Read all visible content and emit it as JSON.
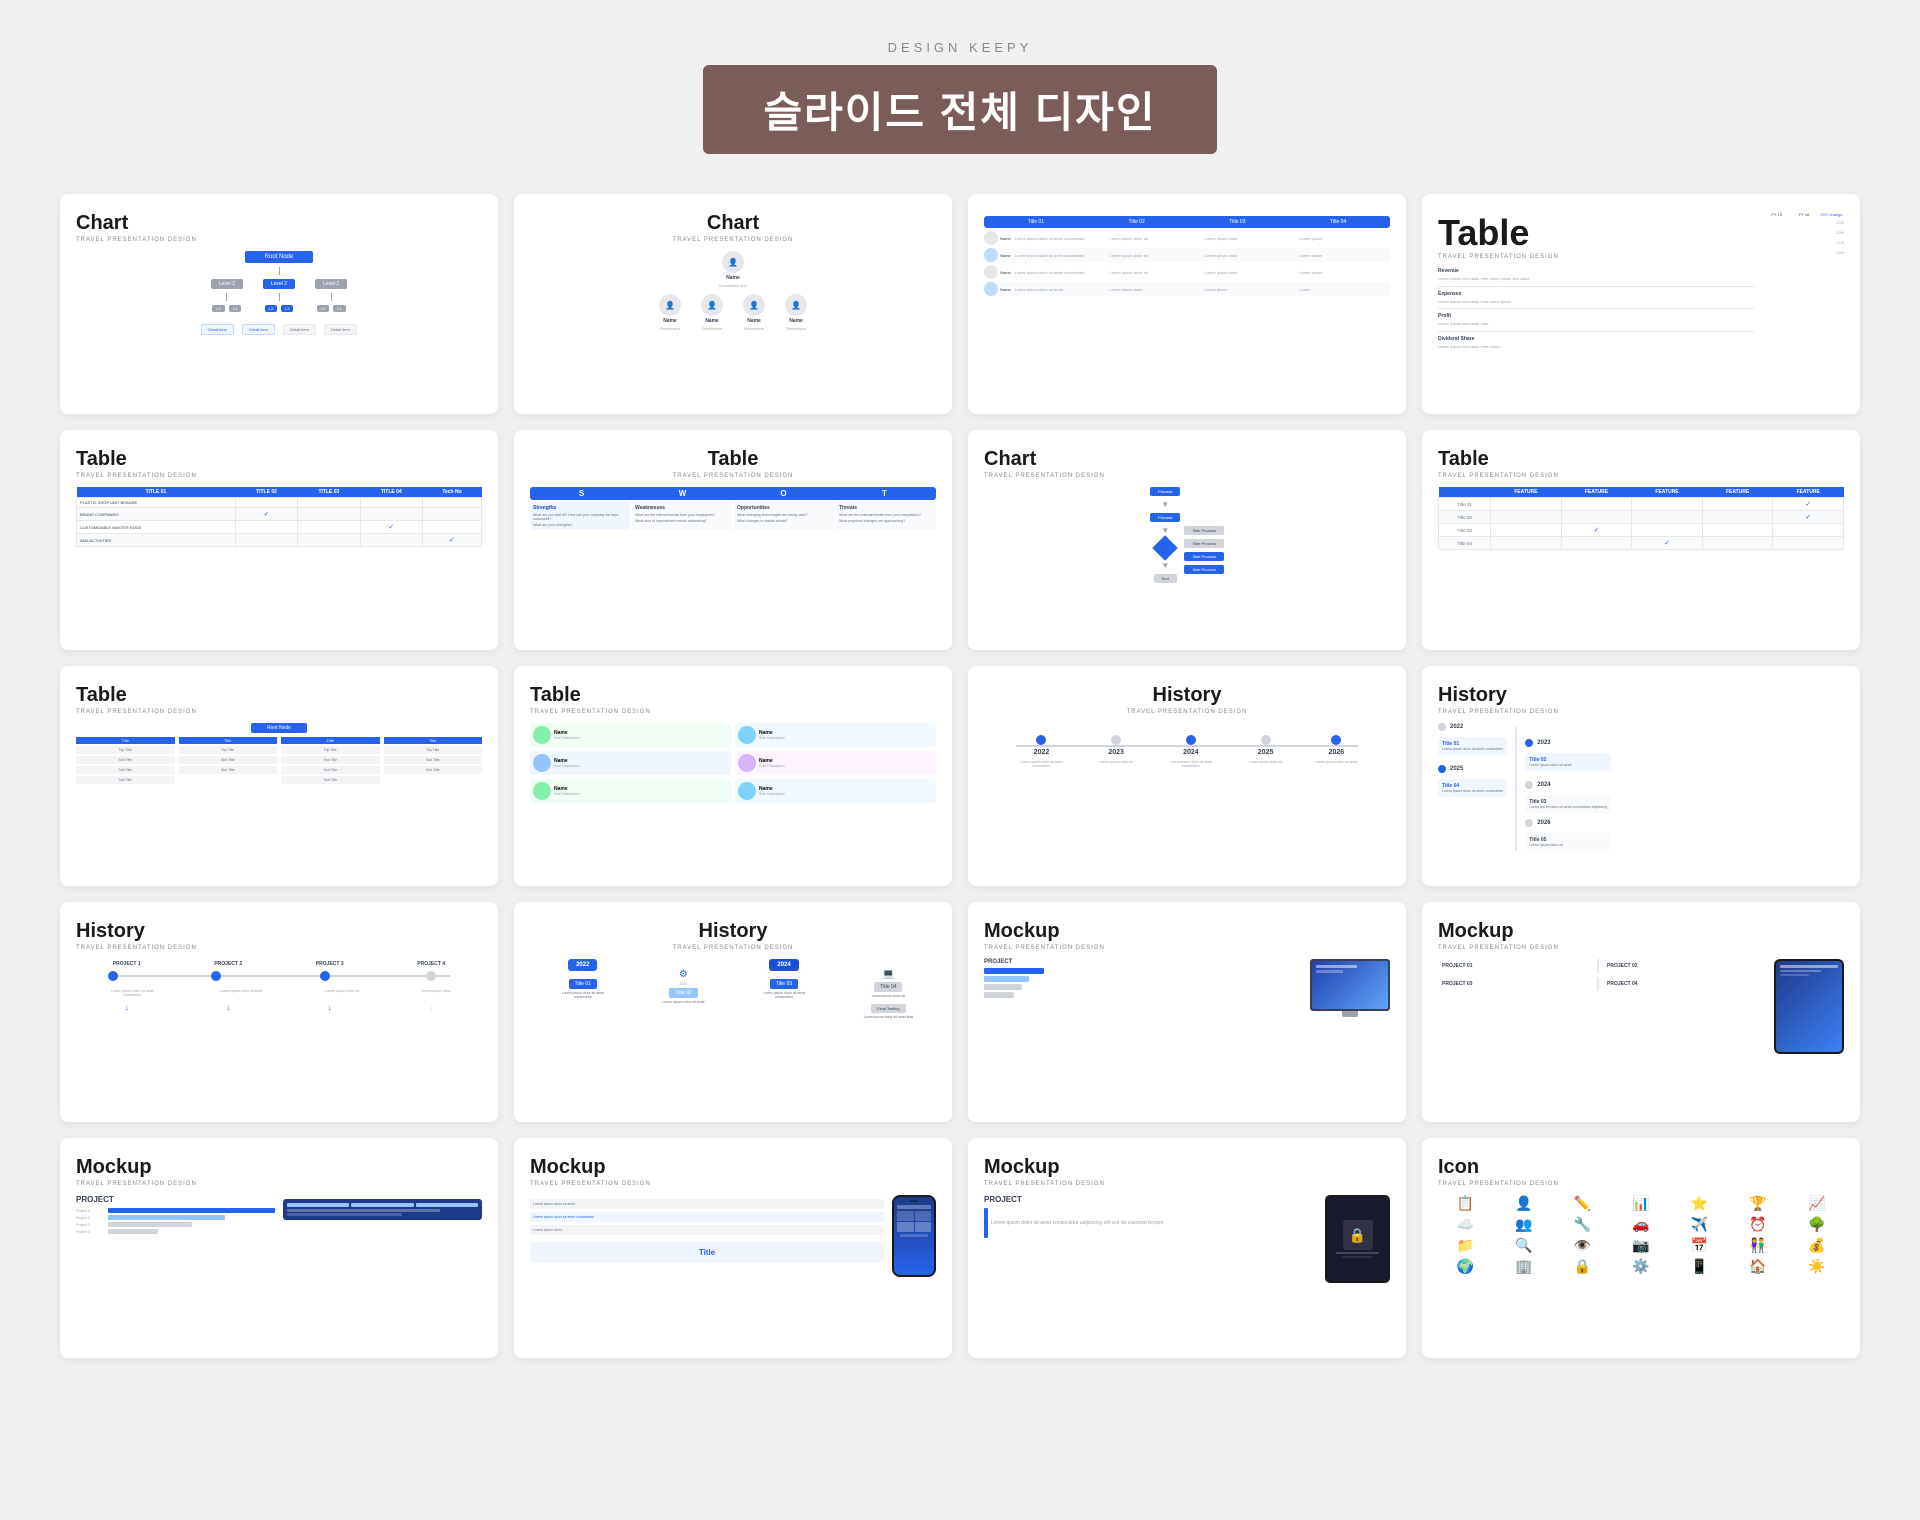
{
  "brand": "DESIGN KEEPY",
  "main_title": "슬라이드 전체 디자인",
  "subtitle": "TRAVEL PRESENTATION DESIGN",
  "slides": [
    {
      "id": "slide-1",
      "type": "chart-org",
      "title": "Chart",
      "subtitle": "TRAVEL PRESENTATION DESIGN"
    },
    {
      "id": "slide-2",
      "type": "chart-person",
      "title": "Chart",
      "subtitle": "TRAVEL PRESENTATION DESIGN"
    },
    {
      "id": "slide-3",
      "type": "table-persons",
      "title": "",
      "subtitle": ""
    },
    {
      "id": "slide-4",
      "type": "table-financial",
      "title": "Table",
      "subtitle": "TRAVEL PRESENTATION DESIGN"
    },
    {
      "id": "slide-5",
      "type": "table-check",
      "title": "Table",
      "subtitle": "TRAVEL PRESENTATION DESIGN"
    },
    {
      "id": "slide-6",
      "type": "table-swot",
      "title": "Table",
      "subtitle": "TRAVEL PRESENTATION DESIGN"
    },
    {
      "id": "slide-7",
      "type": "chart-flow",
      "title": "Chart",
      "subtitle": "TRAVEL PRESENTATION DESIGN"
    },
    {
      "id": "slide-8",
      "type": "table-feature",
      "title": "Table",
      "subtitle": "TRAVEL PRESENTATION DESIGN"
    },
    {
      "id": "slide-9",
      "type": "table-org2",
      "title": "Table",
      "subtitle": "TRAVEL PRESENTATION DESIGN"
    },
    {
      "id": "slide-10",
      "type": "table-persons2",
      "title": "Table",
      "subtitle": "TRAVEL PRESENTATION DESIGN"
    },
    {
      "id": "slide-11",
      "type": "history-horizontal",
      "title": "History",
      "subtitle": "TRAVEL PRESENTATION DESIGN",
      "years": [
        "2022",
        "2023",
        "2024",
        "2025",
        "2026"
      ]
    },
    {
      "id": "slide-12",
      "type": "history-vertical",
      "title": "History",
      "subtitle": "TRAVEL PRESENTATION DESIGN",
      "years": [
        "2022",
        "2023",
        "2024",
        "2025",
        "2026"
      ]
    },
    {
      "id": "slide-13",
      "type": "history-timeline",
      "title": "History",
      "subtitle": "TRAVEL PRESENTATION DESIGN",
      "projects": [
        "PROJECT 1",
        "PROJECT 2",
        "PROJECT 3",
        "PROJECT 4"
      ]
    },
    {
      "id": "slide-14",
      "type": "history-icons",
      "title": "History",
      "subtitle": "TRAVEL PRESENTATION DESIGN",
      "years": [
        "2022",
        "2023",
        "2024"
      ]
    },
    {
      "id": "slide-15",
      "type": "mockup-monitor",
      "title": "Mockup",
      "subtitle": "TRAVEL PRESENTATION DESIGN",
      "project": "PROJECT"
    },
    {
      "id": "slide-16",
      "type": "mockup-tablet",
      "title": "Mockup",
      "subtitle": "TRAVEL PRESENTATION DESIGN",
      "projects": [
        "PROJECT 01",
        "PROJECT 02",
        "PROJECT 03",
        "PROJECT 04"
      ]
    },
    {
      "id": "slide-17",
      "type": "mockup-laptop",
      "title": "Mockup",
      "subtitle": "TRAVEL PRESENTATION DESIGN",
      "project": "PROJECT"
    },
    {
      "id": "slide-18",
      "type": "mockup-phone-blue",
      "title": "Mockup",
      "subtitle": "TRAVEL PRESENTATION DESIGN",
      "title_label": "Title"
    },
    {
      "id": "slide-19",
      "type": "mockup-title",
      "title": "Mockup",
      "subtitle": "TRAVEL PRESENTATION DESIGN",
      "project": "PROJECT"
    },
    {
      "id": "slide-20",
      "type": "icon-grid",
      "title": "Icon",
      "subtitle": "TRAVEL PRESENTATION DESIGN"
    }
  ]
}
